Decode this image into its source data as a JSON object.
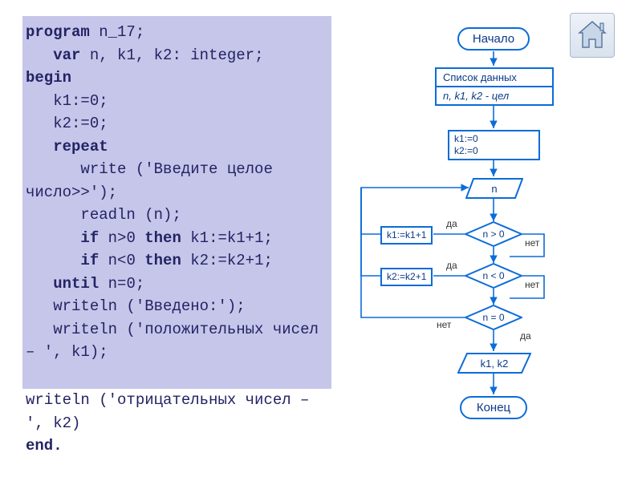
{
  "code": {
    "l1_kw": "program",
    "l1_rest": " n_17;",
    "l2_pre": "   ",
    "l2_kw": "var",
    "l2_rest": " n, k1, k2: integer;",
    "l3_kw": "begin",
    "l4": "   k1:=0;",
    "l5": "   k2:=0;",
    "l6_pre": "   ",
    "l6_kw": "repeat",
    "l7": "      write ('Введите целое число>>');",
    "l8": "      readln (n);",
    "l9_pre": "      ",
    "l9_kw1": "if",
    "l9_mid": " n>0 ",
    "l9_kw2": "then",
    "l9_rest": " k1:=k1+1;",
    "l10_pre": "      ",
    "l10_kw1": "if",
    "l10_mid": " n<0 ",
    "l10_kw2": "then",
    "l10_rest": " k2:=k2+1;",
    "l11_pre": "   ",
    "l11_kw": "until",
    "l11_rest": " n=0;",
    "l12": "   writeln ('Введено:');",
    "l13a": "   writeln ('положительных чисел – ', k1);",
    "l14a": "   writeln ('отрицательных чисел – ', k2)",
    "l15_kw": "end."
  },
  "flow": {
    "start": "Начало",
    "data_hdr": "Список данных",
    "data_body": "n, k1, k2 - цел",
    "init1": "k1:=0",
    "init2": "k2:=0",
    "input_n": "n",
    "cond1": "n > 0",
    "cond2": "n < 0",
    "cond3": "n = 0",
    "act1": "k1:=k1+1",
    "act2": "k2:=k2+1",
    "output": "k1, k2",
    "end": "Конец",
    "yes": "да",
    "no": "нет"
  },
  "icons": {
    "home": "home-icon"
  }
}
